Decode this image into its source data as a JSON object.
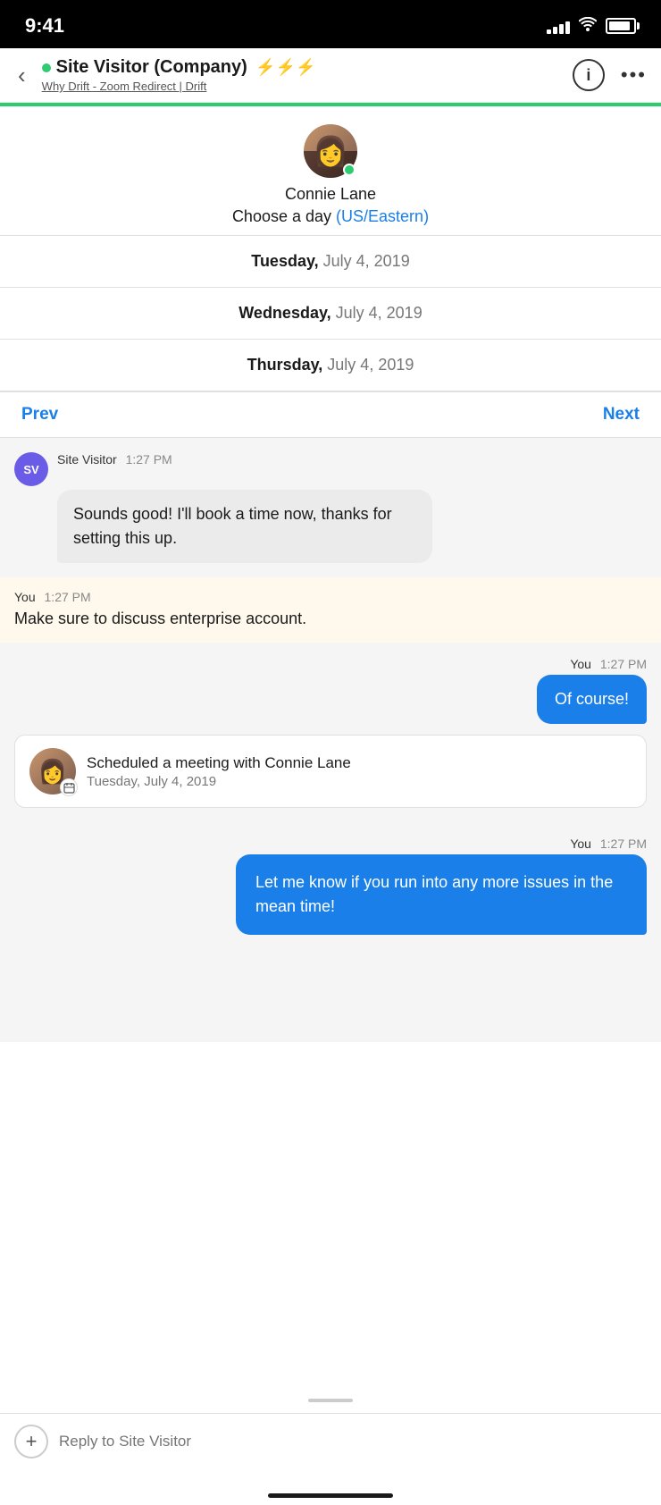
{
  "status_bar": {
    "time": "9:41"
  },
  "header": {
    "back_label": "<",
    "online_indicator": "online",
    "name": "Site Visitor (Company)",
    "lightning": "⚡⚡⚡",
    "subtitle": "Why Drift - Zoom Redirect | Drift",
    "info_label": "i",
    "more_label": "•••"
  },
  "calendar": {
    "agent_name": "Connie Lane",
    "choose_day_label": "Choose a day",
    "timezone": "(US/Eastern)",
    "dates": [
      {
        "day": "Tuesday,",
        "date": " July 4, 2019"
      },
      {
        "day": "Wednesday,",
        "date": " July 4, 2019"
      },
      {
        "day": "Thursday,",
        "date": " July 4, 2019"
      }
    ],
    "prev_label": "Prev",
    "next_label": "Next"
  },
  "messages": [
    {
      "type": "visitor_bubble",
      "sender": "Site Visitor",
      "time": "1:27 PM",
      "avatar": "SV",
      "text": "Sounds good! I'll book a time now, thanks for setting this up."
    },
    {
      "type": "internal_note",
      "sender": "You",
      "time": "1:27 PM",
      "text": "Make sure to discuss enterprise account."
    },
    {
      "type": "agent_bubble",
      "sender": "You",
      "time": "1:27 PM",
      "text": "Of course!"
    },
    {
      "type": "meeting_card",
      "title": "Scheduled a meeting with Connie Lane",
      "date": "Tuesday, July 4, 2019"
    },
    {
      "type": "agent_bubble_large",
      "sender": "You",
      "time": "1:27 PM",
      "text": "Let me know if you run into any more issues in the mean time!"
    }
  ],
  "reply_bar": {
    "plus_label": "+",
    "placeholder": "Reply to Site Visitor"
  }
}
